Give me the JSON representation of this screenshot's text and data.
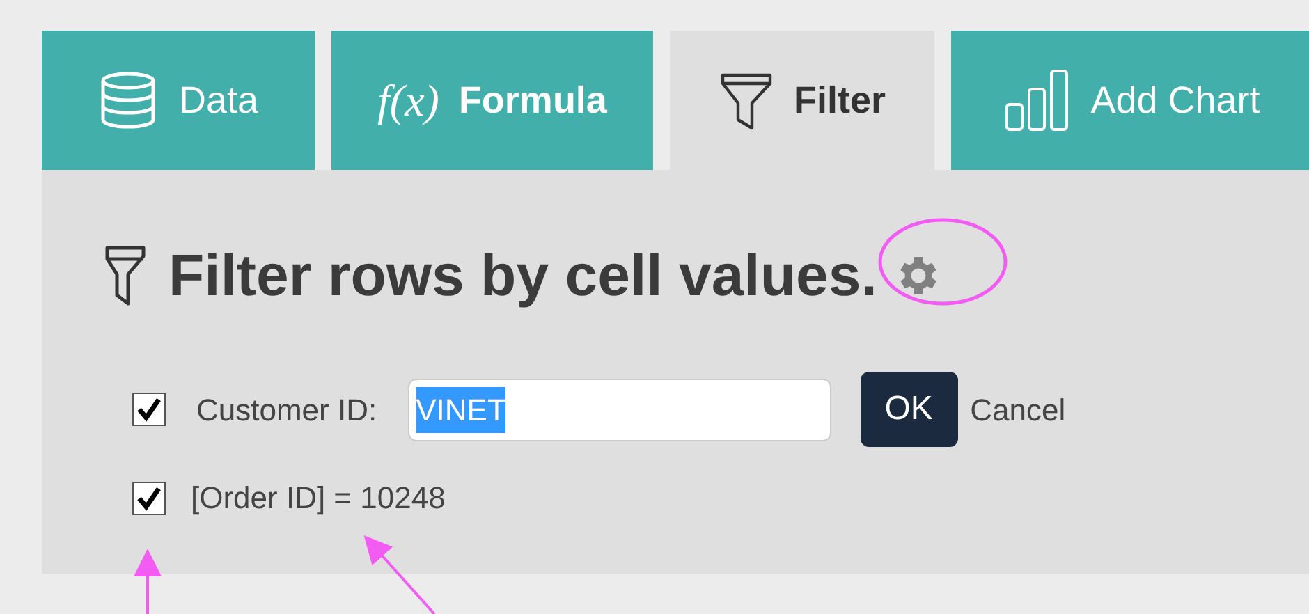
{
  "tabs": [
    {
      "label": "Data",
      "kind": "database",
      "selected": false,
      "bold": false
    },
    {
      "label": "Formula",
      "kind": "function",
      "icon_text": "f(x)",
      "selected": false,
      "bold": true
    },
    {
      "label": "Filter",
      "kind": "funnel",
      "selected": true,
      "bold": true
    },
    {
      "label": "Add Chart",
      "kind": "chart",
      "selected": false,
      "bold": false
    }
  ],
  "panel": {
    "title": "Filter rows by cell values.",
    "filters": [
      {
        "kind": "field",
        "checked": true,
        "label": "Customer ID:",
        "value": "VINET",
        "value_selected": true,
        "ok": "OK",
        "cancel": "Cancel"
      },
      {
        "kind": "expression",
        "checked": true,
        "text": "[Order ID] = 10248"
      }
    ]
  }
}
